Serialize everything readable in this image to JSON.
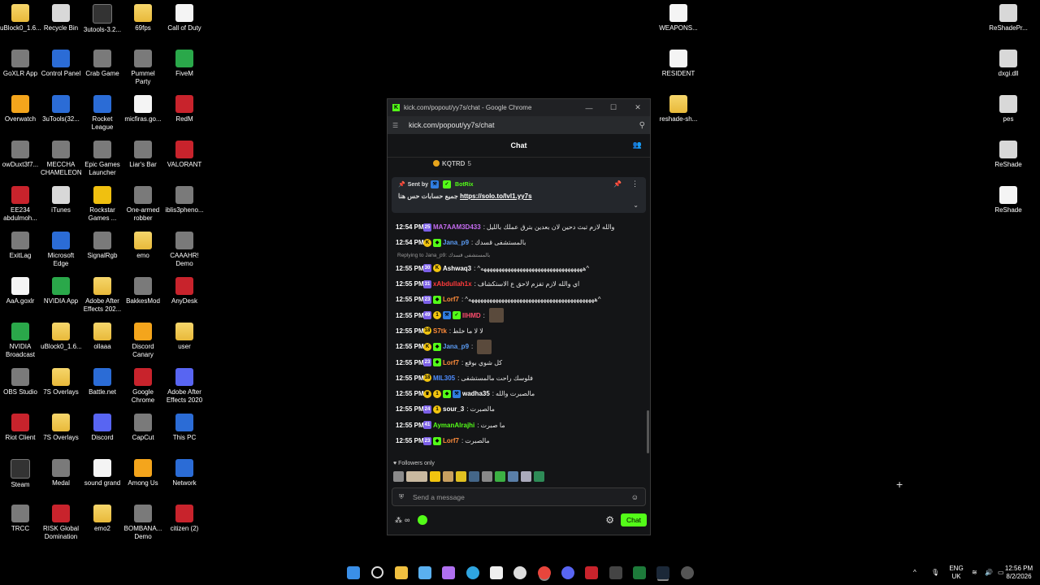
{
  "desktop_icons": [
    {
      "label": "uBlock0_1.6...",
      "icon": "folder-icon"
    },
    {
      "label": "Recycle Bin",
      "icon": "recycle-bin-icon"
    },
    {
      "label": "3utools-3.2...",
      "icon": "download-icon"
    },
    {
      "label": "69fps",
      "icon": "folder-icon"
    },
    {
      "label": "Call of Duty",
      "icon": "file-icon"
    },
    {
      "label": "GoXLR App",
      "icon": "goxlr-icon"
    },
    {
      "label": "Control Panel",
      "icon": "control-panel-icon"
    },
    {
      "label": "Crab Game",
      "icon": "crab-game-icon"
    },
    {
      "label": "Pummel Party",
      "icon": "pummel-party-icon"
    },
    {
      "label": "FiveM",
      "icon": "fivem-icon"
    },
    {
      "label": "Overwatch",
      "icon": "overwatch-icon"
    },
    {
      "label": "3uTools(32...",
      "icon": "3utools-icon"
    },
    {
      "label": "Rocket League",
      "icon": "rocket-league-icon"
    },
    {
      "label": "micfiras.go...",
      "icon": "file-icon"
    },
    {
      "label": "RedM",
      "icon": "redm-icon"
    },
    {
      "label": "owDuxt3f7...",
      "icon": "image-icon"
    },
    {
      "label": "MECCHA CHAMELEON",
      "icon": "game-icon"
    },
    {
      "label": "Epic Games Launcher",
      "icon": "epic-games-icon"
    },
    {
      "label": "Liar's Bar",
      "icon": "liars-bar-icon"
    },
    {
      "label": "VALORANT",
      "icon": "valorant-icon"
    },
    {
      "label": "EE234 abdulmoh...",
      "icon": "pdf-icon"
    },
    {
      "label": "iTunes",
      "icon": "itunes-icon"
    },
    {
      "label": "Rockstar Games ...",
      "icon": "rockstar-icon"
    },
    {
      "label": "One-armed robber",
      "icon": "game-icon"
    },
    {
      "label": "iblis3pheno...",
      "icon": "image-icon"
    },
    {
      "label": "ExitLag",
      "icon": "exitlag-icon"
    },
    {
      "label": "Microsoft Edge",
      "icon": "edge-icon"
    },
    {
      "label": "SignalRgb",
      "icon": "signalrgb-icon"
    },
    {
      "label": "emo",
      "icon": "folder-icon"
    },
    {
      "label": "CAAAHR! Demo",
      "icon": "game-icon"
    },
    {
      "label": "AaA.goxlr",
      "icon": "file-icon"
    },
    {
      "label": "NVIDIA App",
      "icon": "nvidia-icon"
    },
    {
      "label": "Adobe After Effects 202...",
      "icon": "folder-icon"
    },
    {
      "label": "BakkesMod",
      "icon": "bakkesmod-icon"
    },
    {
      "label": "AnyDesk",
      "icon": "anydesk-icon"
    },
    {
      "label": "NVIDIA Broadcast",
      "icon": "nvidia-broadcast-icon"
    },
    {
      "label": "uBlock0_1.6...",
      "icon": "folder-icon"
    },
    {
      "label": "ollaaa",
      "icon": "folder-icon"
    },
    {
      "label": "Discord Canary",
      "icon": "discord-canary-icon"
    },
    {
      "label": "user",
      "icon": "folder-icon"
    },
    {
      "label": "OBS Studio",
      "icon": "obs-icon"
    },
    {
      "label": "7S Overlays",
      "icon": "folder-icon"
    },
    {
      "label": "Battle.net",
      "icon": "battlenet-icon"
    },
    {
      "label": "Google Chrome",
      "icon": "chrome-icon"
    },
    {
      "label": "Adobe After Effects 2020",
      "icon": "after-effects-icon"
    },
    {
      "label": "Riot Client",
      "icon": "riot-icon"
    },
    {
      "label": "7S Overlays",
      "icon": "folder-icon"
    },
    {
      "label": "Discord",
      "icon": "discord-icon"
    },
    {
      "label": "CapCut",
      "icon": "capcut-icon"
    },
    {
      "label": "This PC",
      "icon": "this-pc-icon"
    },
    {
      "label": "Steam",
      "icon": "steam-icon"
    },
    {
      "label": "Medal",
      "icon": "medal-icon"
    },
    {
      "label": "sound grand",
      "icon": "file-icon"
    },
    {
      "label": "Among Us",
      "icon": "among-us-icon"
    },
    {
      "label": "Network",
      "icon": "network-icon"
    },
    {
      "label": "TRCC",
      "icon": "trcc-icon"
    },
    {
      "label": "RISK Global Domination",
      "icon": "risk-icon"
    },
    {
      "label": "emo2",
      "icon": "folder-icon"
    },
    {
      "label": "BOMBANA... Demo",
      "icon": "game-icon"
    },
    {
      "label": "citizen (2)",
      "icon": "winrar-icon"
    },
    {
      "label": "WEAPONS...",
      "icon": "file-icon"
    },
    {
      "label": "RESIDENT",
      "icon": "file-icon"
    },
    {
      "label": "reshade-sh...",
      "icon": "folder-icon"
    },
    {
      "label": "ReShadePr...",
      "icon": "settings-file-icon"
    },
    {
      "label": "dxgi.dll",
      "icon": "settings-file-icon"
    },
    {
      "label": "pes",
      "icon": "settings-file-icon"
    },
    {
      "label": "ReShade",
      "icon": "settings-file-icon"
    },
    {
      "label": "ReShade",
      "icon": "file-icon"
    }
  ],
  "window": {
    "title": "kick.com/popout/yy7s/chat - Google Chrome",
    "url": "kick.com/popout/yy7s/chat",
    "minimize": "—",
    "maximize": "☐",
    "close": "✕"
  },
  "chat": {
    "header": "Chat",
    "top_stub_user": "KQTRD",
    "top_stub_badge": "5",
    "pinned": {
      "sent_by_label": "Sent by",
      "bot_name": "BotRix",
      "message": "جميع حسابات حس هنا",
      "link": "https://solo.to/lvl1.yy7s"
    },
    "messages": [
      {
        "time": "12:54 PM",
        "badges": [
          {
            "t": "sub",
            "v": "25"
          }
        ],
        "user": "MA7AAM3D433",
        "color": "#c56cf0",
        "text": "والله لازم تبث دحين لان بعدين بترق عملك بالليل"
      },
      {
        "time": "12:54 PM",
        "badges": [
          {
            "t": "gold",
            "v": "K"
          },
          {
            "t": "green",
            "v": "◆"
          }
        ],
        "user": "Jana_p9",
        "color": "#5b9cf5",
        "text": "بالمستشفى قسدك"
      },
      {
        "reply": "Replying to Jana_p9: بالمستشفى قسدك"
      },
      {
        "time": "12:55 PM",
        "badges": [
          {
            "t": "sub",
            "v": "30"
          },
          {
            "t": "gold",
            "v": "K"
          }
        ],
        "user": "Ashwaq3",
        "color": "#ffffff",
        "text": "^ههههههههههههههههههههههههههههههههههه^"
      },
      {
        "time": "12:55 PM",
        "badges": [
          {
            "t": "sub",
            "v": "31"
          }
        ],
        "user": "xAbdullah1x",
        "color": "#ff3b3b",
        "text": "اي والله لازم تفزم لاحق ع الاستكشاف"
      },
      {
        "time": "12:55 PM",
        "badges": [
          {
            "t": "sub",
            "v": "23"
          },
          {
            "t": "green",
            "v": "◆"
          }
        ],
        "user": "Lorf7",
        "color": "#ff8c3b",
        "text": "^ههههههههههههههههههههههههههههههههههههههههههه^"
      },
      {
        "time": "12:55 PM",
        "badges": [
          {
            "t": "sub",
            "v": "49"
          },
          {
            "t": "gold",
            "v": "1"
          },
          {
            "t": "blue",
            "v": "⚒"
          },
          {
            "t": "green",
            "v": "✓"
          }
        ],
        "user": "IIHMD",
        "color": "#ff4d6d",
        "text": "",
        "emote": true
      },
      {
        "time": "12:55 PM",
        "badges": [
          {
            "t": "gold",
            "v": "18"
          }
        ],
        "user": "S7tk",
        "color": "#ff8c3b",
        "text": "لا لا ما خلط"
      },
      {
        "time": "12:55 PM",
        "badges": [
          {
            "t": "gold",
            "v": "K"
          },
          {
            "t": "green",
            "v": "◆"
          }
        ],
        "user": "Jana_p9",
        "color": "#5b9cf5",
        "text": "",
        "emote": true
      },
      {
        "time": "12:55 PM",
        "badges": [
          {
            "t": "sub",
            "v": "23"
          },
          {
            "t": "green",
            "v": "◆"
          }
        ],
        "user": "Lorf7",
        "color": "#ff8c3b",
        "text": "كل شوي بوقع"
      },
      {
        "time": "12:55 PM",
        "badges": [
          {
            "t": "gold",
            "v": "18"
          }
        ],
        "user": "MIL305",
        "color": "#4e8cff",
        "text": "فلوسك راحت مالمستشفى"
      },
      {
        "time": "12:55 PM",
        "badges": [
          {
            "t": "gold",
            "v": "♛"
          },
          {
            "t": "gold",
            "v": "1"
          },
          {
            "t": "green",
            "v": "◆"
          },
          {
            "t": "blue",
            "v": "⚒"
          }
        ],
        "user": "wadha35",
        "color": "#ffffff",
        "text": "مالصبرت والله"
      },
      {
        "time": "12:55 PM",
        "badges": [
          {
            "t": "sub",
            "v": "24"
          },
          {
            "t": "gold",
            "v": "1"
          }
        ],
        "user": "sour_3",
        "color": "#ffffff",
        "text": "مالصبرت"
      },
      {
        "time": "12:55 PM",
        "badges": [
          {
            "t": "sub",
            "v": "41"
          }
        ],
        "user": "AymanAlrajhi",
        "color": "#53fc18",
        "text": "ما صبرت"
      },
      {
        "time": "12:55 PM",
        "badges": [
          {
            "t": "sub",
            "v": "23"
          },
          {
            "t": "green",
            "v": "◆"
          }
        ],
        "user": "Lorf7",
        "color": "#ff8c3b",
        "text": "مالصبرت"
      }
    ],
    "followers_only": "Followers only",
    "input_placeholder": "Send a message",
    "chat_button": "Chat",
    "infinity": "∞"
  },
  "taskbar": {
    "lang_top": "ENG",
    "lang_bottom": "UK",
    "time": "12:56 PM",
    "date": "8/2/2026"
  },
  "colors": {
    "accent": "#53fc18",
    "window_bg": "#141517",
    "desktop_bg": "#000000"
  }
}
